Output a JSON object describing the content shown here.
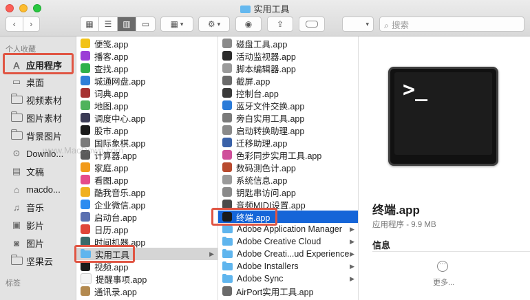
{
  "window": {
    "title": "实用工具"
  },
  "toolbar": {
    "search_placeholder": "搜索"
  },
  "sidebar": {
    "favorites_header": "个人收藏",
    "tags_header": "标签",
    "items": [
      {
        "label": "应用程序",
        "icon": "applications-icon"
      },
      {
        "label": "桌面",
        "icon": "desktop-icon"
      },
      {
        "label": "视频素材",
        "icon": "folder-icon"
      },
      {
        "label": "图片素材",
        "icon": "folder-icon"
      },
      {
        "label": "背景图片",
        "icon": "folder-icon"
      },
      {
        "label": "Downlo...",
        "icon": "downloads-icon"
      },
      {
        "label": "文稿",
        "icon": "documents-icon"
      },
      {
        "label": "macdo...",
        "icon": "home-icon"
      },
      {
        "label": "音乐",
        "icon": "music-icon"
      },
      {
        "label": "影片",
        "icon": "movies-icon"
      },
      {
        "label": "图片",
        "icon": "pictures-icon"
      },
      {
        "label": "坚果云",
        "icon": "folder-icon"
      }
    ]
  },
  "applications_column": [
    {
      "label": "便笺.app",
      "color": "#f2c318"
    },
    {
      "label": "播客.app",
      "color": "#9b3fd6"
    },
    {
      "label": "查找.app",
      "color": "#2fb14a"
    },
    {
      "label": "城通网盘.app",
      "color": "#2f7fd8"
    },
    {
      "label": "词典.app",
      "color": "#a63232"
    },
    {
      "label": "地图.app",
      "color": "#4fb35c"
    },
    {
      "label": "调度中心.app",
      "color": "#3c3c56"
    },
    {
      "label": "股市.app",
      "color": "#1a1a1a"
    },
    {
      "label": "国际象棋.app",
      "color": "#7b7b7b"
    },
    {
      "label": "计算器.app",
      "color": "#5a5a5a"
    },
    {
      "label": "家庭.app",
      "color": "#f29a1a"
    },
    {
      "label": "看图.app",
      "color": "#e54b8a"
    },
    {
      "label": "酷我音乐.app",
      "color": "#f0b020"
    },
    {
      "label": "企业微信.app",
      "color": "#2d8cf0"
    },
    {
      "label": "启动台.app",
      "color": "#5a6fb0"
    },
    {
      "label": "日历.app",
      "color": "#e0463a"
    },
    {
      "label": "时间机器.app",
      "color": "#3a6a6a"
    },
    {
      "label": "实用工具",
      "folder": true,
      "selected": true
    },
    {
      "label": "视频.app",
      "color": "#1a1a1a"
    },
    {
      "label": "提醒事项.app",
      "color": "#f4f4f4"
    },
    {
      "label": "通讯录.app",
      "color": "#b3894f"
    }
  ],
  "utilities_column": [
    {
      "label": "磁盘工具.app",
      "color": "#8a8a8a"
    },
    {
      "label": "活动监视器.app",
      "color": "#2c2c2c"
    },
    {
      "label": "脚本编辑器.app",
      "color": "#9a9a9a"
    },
    {
      "label": "截屏.app",
      "color": "#6a6a6a"
    },
    {
      "label": "控制台.app",
      "color": "#3a3a3a"
    },
    {
      "label": "蓝牙文件交换.app",
      "color": "#2a7bd8"
    },
    {
      "label": "旁白实用工具.app",
      "color": "#7a7a7a"
    },
    {
      "label": "启动转换助理.app",
      "color": "#8a8a8a"
    },
    {
      "label": "迁移助理.app",
      "color": "#3a62a8"
    },
    {
      "label": "色彩同步实用工具.app",
      "color": "#cf4f9a"
    },
    {
      "label": "数码测色计.app",
      "color": "#b84a2e"
    },
    {
      "label": "系统信息.app",
      "color": "#9a9a9a"
    },
    {
      "label": "钥匙串访问.app",
      "color": "#8a8a8a"
    },
    {
      "label": "音频MIDI设置.app",
      "color": "#4a4a4a"
    },
    {
      "label": "终端.app",
      "color": "#1a1a1a",
      "selected": true
    },
    {
      "label": "Adobe Application Manager",
      "folder": true
    },
    {
      "label": "Adobe Creative Cloud",
      "folder": true
    },
    {
      "label": "Adobe Creati...ud Experience",
      "folder": true
    },
    {
      "label": "Adobe Installers",
      "folder": true
    },
    {
      "label": "Adobe Sync",
      "folder": true
    },
    {
      "label": "AirPort实用工具.app",
      "color": "#6a6a6a"
    }
  ],
  "preview": {
    "icon_prompt": ">_",
    "name": "终端.app",
    "kind": "应用程序 - 9.9 MB",
    "info_label": "信息",
    "more_label": "更多..."
  },
  "watermark": "www.MacDown.com",
  "colors": {
    "highlight": "#e05543",
    "selection": "#1565d8",
    "folder": "#5fb5ee"
  }
}
